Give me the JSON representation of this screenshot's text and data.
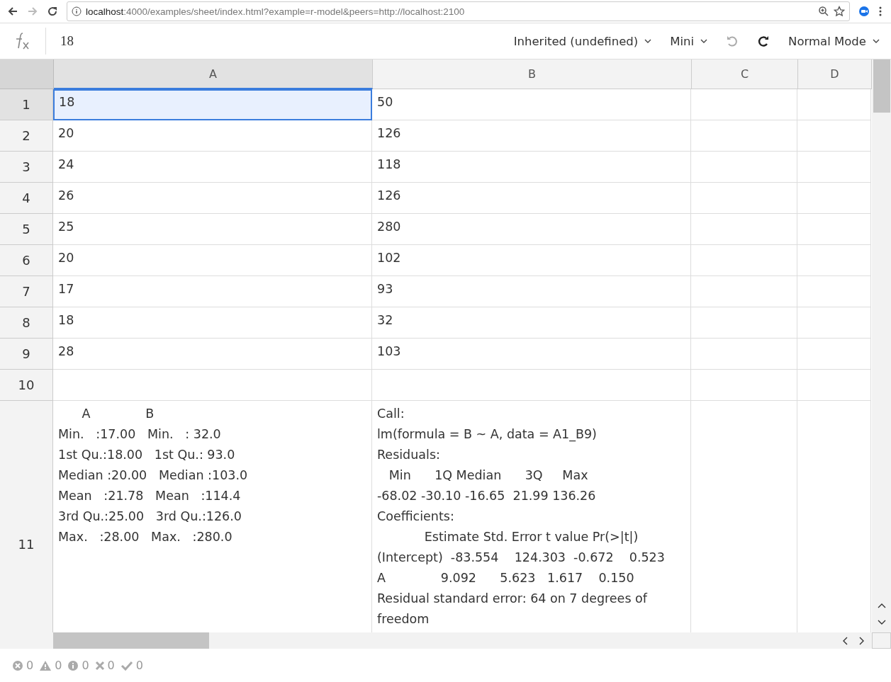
{
  "browser": {
    "url_host": "localhost",
    "url_rest": ":4000/examples/sheet/index.html?example=r-model&peers=http://localhost:2100",
    "forward_disabled": true
  },
  "toolbar": {
    "formula": "18",
    "menus": [
      {
        "kind": "dropdown",
        "label": "Inherited (undefined)"
      },
      {
        "kind": "dropdown",
        "label": "Mini"
      },
      {
        "kind": "undo",
        "disabled": true
      },
      {
        "kind": "redo",
        "disabled": false
      },
      {
        "kind": "dropdown",
        "label": "Normal Mode"
      }
    ]
  },
  "sheet": {
    "columns": [
      "A",
      "B",
      "C",
      "D"
    ],
    "rows": [
      {
        "header": "1",
        "cells": [
          {
            "lines": [
              "18"
            ],
            "selected": true
          },
          {
            "lines": [
              "50"
            ],
            "selected": false
          },
          {
            "selected": false
          },
          {
            "selected": false
          }
        ]
      },
      {
        "header": "2",
        "cells": [
          {
            "lines": [
              "20"
            ],
            "selected": false
          },
          {
            "lines": [
              "126"
            ],
            "selected": false
          },
          {
            "selected": false
          },
          {
            "selected": false
          }
        ]
      },
      {
        "header": "3",
        "cells": [
          {
            "lines": [
              "24"
            ],
            "selected": false
          },
          {
            "lines": [
              "118"
            ],
            "selected": false
          },
          {
            "selected": false
          },
          {
            "selected": false
          }
        ]
      },
      {
        "header": "4",
        "cells": [
          {
            "lines": [
              "26"
            ],
            "selected": false
          },
          {
            "lines": [
              "126"
            ],
            "selected": false
          },
          {
            "selected": false
          },
          {
            "selected": false
          }
        ]
      },
      {
        "header": "5",
        "cells": [
          {
            "lines": [
              "25"
            ],
            "selected": false
          },
          {
            "lines": [
              "280"
            ],
            "selected": false
          },
          {
            "selected": false
          },
          {
            "selected": false
          }
        ]
      },
      {
        "header": "6",
        "cells": [
          {
            "lines": [
              "20"
            ],
            "selected": false
          },
          {
            "lines": [
              "102"
            ],
            "selected": false
          },
          {
            "selected": false
          },
          {
            "selected": false
          }
        ]
      },
      {
        "header": "7",
        "cells": [
          {
            "lines": [
              "17"
            ],
            "selected": false
          },
          {
            "lines": [
              "93"
            ],
            "selected": false
          },
          {
            "selected": false
          },
          {
            "selected": false
          }
        ]
      },
      {
        "header": "8",
        "cells": [
          {
            "lines": [
              "18"
            ],
            "selected": false
          },
          {
            "lines": [
              "32"
            ],
            "selected": false
          },
          {
            "selected": false
          },
          {
            "selected": false
          }
        ]
      },
      {
        "header": "9",
        "cells": [
          {
            "lines": [
              "28"
            ],
            "selected": false
          },
          {
            "lines": [
              "103"
            ],
            "selected": false
          },
          {
            "selected": false
          },
          {
            "selected": false
          }
        ]
      },
      {
        "header": "10",
        "cells": [
          {
            "selected": false
          },
          {
            "selected": false
          },
          {
            "selected": false
          },
          {
            "selected": false
          }
        ]
      },
      {
        "header": "11",
        "cells": [
          {
            "lines": [
              "      A              B",
              "Min.   :17.00   Min.   : 32.0",
              "1st Qu.:18.00   1st Qu.: 93.0",
              "Median :20.00   Median :103.0",
              "Mean   :21.78   Mean   :114.4",
              "3rd Qu.:25.00   3rd Qu.:126.0",
              "Max.   :28.00   Max.   :280.0"
            ],
            "selected": false
          },
          {
            "lines": [
              "Call:",
              "lm(formula = B ~ A, data = A1_B9)",
              "Residuals:",
              "   Min      1Q Median      3Q     Max",
              "-68.02 -30.10 -16.65  21.99 136.26",
              "Coefficients:",
              "            Estimate Std. Error t value Pr(>|t|)",
              "(Intercept)  -83.554    124.303  -0.672    0.523",
              "A              9.092      5.623   1.617    0.150",
              "Residual standard error: 64 on 7 degrees of freedom"
            ],
            "selected": false
          },
          {
            "selected": false
          },
          {
            "selected": false
          }
        ]
      }
    ]
  },
  "status_bar": [
    {
      "kind": "error",
      "count": "0"
    },
    {
      "kind": "warning",
      "count": "0"
    },
    {
      "kind": "info",
      "count": "0"
    },
    {
      "kind": "cross",
      "count": "0"
    },
    {
      "kind": "check",
      "count": "0"
    }
  ]
}
